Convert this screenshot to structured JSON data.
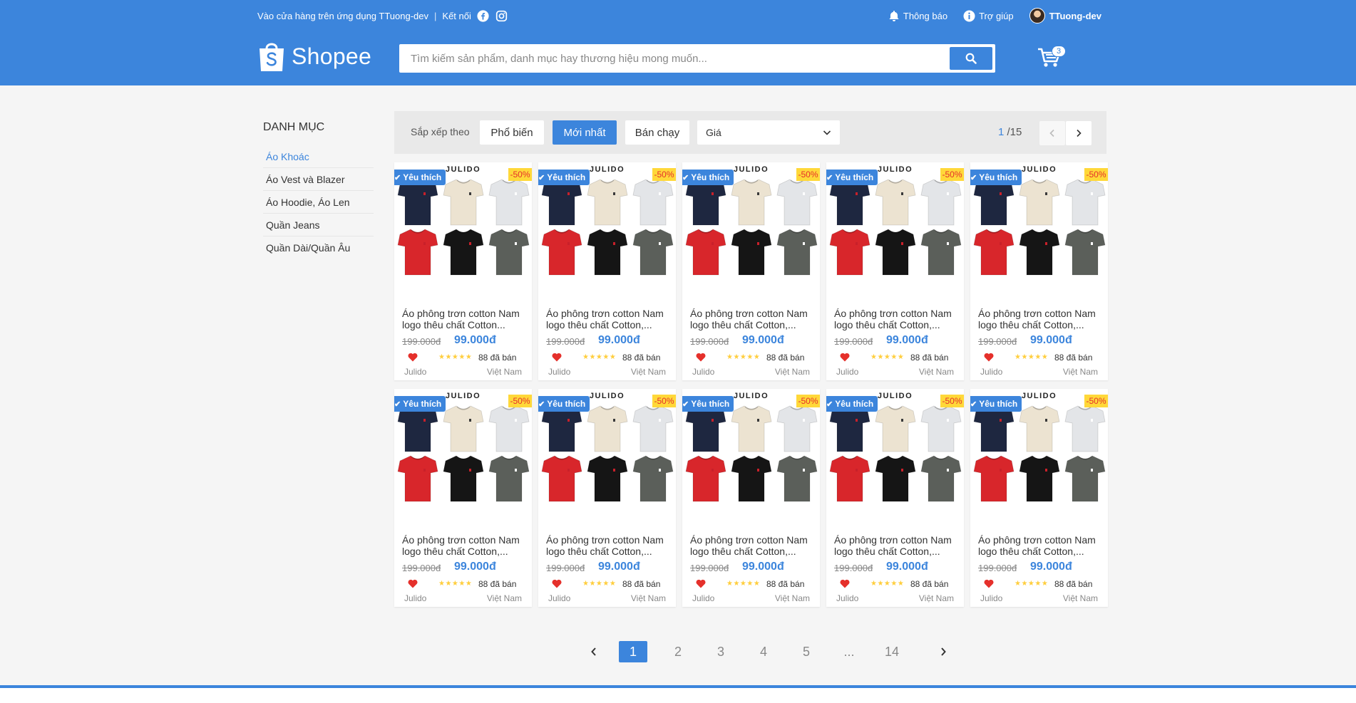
{
  "header": {
    "store_link": "Vào cửa hàng trên ứng dụng TTuong-dev",
    "connect_label": "Kết nối",
    "notification_label": "Thông báo",
    "help_label": "Trợ giúp",
    "username": "TTuong-dev",
    "logo_text": "Shopee",
    "search_placeholder": "Tìm kiếm sản phẩm, danh mục hay thương hiệu mong muốn...",
    "cart_count": "3",
    "brand_color": "#3c85dc"
  },
  "sidebar": {
    "title": "DANH MỤC",
    "items": [
      {
        "label": "Áo Khoác",
        "active": true
      },
      {
        "label": "Áo Vest và Blazer",
        "active": false
      },
      {
        "label": "Áo Hoodie, Áo Len",
        "active": false
      },
      {
        "label": "Quần Jeans",
        "active": false
      },
      {
        "label": "Quần Dài/Quần Âu",
        "active": false
      }
    ]
  },
  "filter": {
    "sort_label": "Sắp xếp theo",
    "buttons": [
      {
        "label": "Phổ biến",
        "active": false
      },
      {
        "label": "Mới nhất",
        "active": true
      },
      {
        "label": "Bán chạy",
        "active": false
      }
    ],
    "price_select": "Giá",
    "current_page": "1",
    "total_pages": "/15"
  },
  "products": [
    {
      "name": "Áo phông trơn cotton Nam logo thêu chất Cotton...",
      "old_price": "199.000đ",
      "price": "99.000đ",
      "sold": "88 đã bán",
      "shop": "Julido",
      "origin": "Việt Nam",
      "badge": "Yêu thích",
      "discount": "-50%",
      "brand": "JULIDO",
      "rating": "★★★★★"
    },
    {
      "name": "Áo phông trơn cotton Nam logo thêu chất Cotton,...",
      "old_price": "199.000đ",
      "price": "99.000đ",
      "sold": "88 đã bán",
      "shop": "Julido",
      "origin": "Việt Nam",
      "badge": "Yêu thích",
      "discount": "-50%",
      "brand": "JULIDO",
      "rating": "★★★★★"
    },
    {
      "name": "Áo phông trơn cotton Nam logo thêu chất Cotton,...",
      "old_price": "199.000đ",
      "price": "99.000đ",
      "sold": "88 đã bán",
      "shop": "Julido",
      "origin": "Việt Nam",
      "badge": "Yêu thích",
      "discount": "-50%",
      "brand": "JULIDO",
      "rating": "★★★★★"
    },
    {
      "name": "Áo phông trơn cotton Nam logo thêu chất Cotton,...",
      "old_price": "199.000đ",
      "price": "99.000đ",
      "sold": "88 đã bán",
      "shop": "Julido",
      "origin": "Việt Nam",
      "badge": "Yêu thích",
      "discount": "-50%",
      "brand": "JULIDO",
      "rating": "★★★★★"
    },
    {
      "name": "Áo phông trơn cotton Nam logo thêu chất Cotton,...",
      "old_price": "199.000đ",
      "price": "99.000đ",
      "sold": "88 đã bán",
      "shop": "Julido",
      "origin": "Việt Nam",
      "badge": "Yêu thích",
      "discount": "-50%",
      "brand": "JULIDO",
      "rating": "★★★★★"
    },
    {
      "name": "Áo phông trơn cotton Nam logo thêu chất Cotton,...",
      "old_price": "199.000đ",
      "price": "99.000đ",
      "sold": "88 đã bán",
      "shop": "Julido",
      "origin": "Việt Nam",
      "badge": "Yêu thích",
      "discount": "-50%",
      "brand": "JULIDO",
      "rating": "★★★★★"
    },
    {
      "name": "Áo phông trơn cotton Nam logo thêu chất Cotton,...",
      "old_price": "199.000đ",
      "price": "99.000đ",
      "sold": "88 đã bán",
      "shop": "Julido",
      "origin": "Việt Nam",
      "badge": "Yêu thích",
      "discount": "-50%",
      "brand": "JULIDO",
      "rating": "★★★★★"
    },
    {
      "name": "Áo phông trơn cotton Nam logo thêu chất Cotton,...",
      "old_price": "199.000đ",
      "price": "99.000đ",
      "sold": "88 đã bán",
      "shop": "Julido",
      "origin": "Việt Nam",
      "badge": "Yêu thích",
      "discount": "-50%",
      "brand": "JULIDO",
      "rating": "★★★★★"
    },
    {
      "name": "Áo phông trơn cotton Nam logo thêu chất Cotton,...",
      "old_price": "199.000đ",
      "price": "99.000đ",
      "sold": "88 đã bán",
      "shop": "Julido",
      "origin": "Việt Nam",
      "badge": "Yêu thích",
      "discount": "-50%",
      "brand": "JULIDO",
      "rating": "★★★★★"
    },
    {
      "name": "Áo phông trơn cotton Nam logo thêu chất Cotton,...",
      "old_price": "199.000đ",
      "price": "99.000đ",
      "sold": "88 đã bán",
      "shop": "Julido",
      "origin": "Việt Nam",
      "badge": "Yêu thích",
      "discount": "-50%",
      "brand": "JULIDO",
      "rating": "★★★★★"
    }
  ],
  "shirt_colors": [
    "#1e2740",
    "#ece3d1",
    "#e3e5e8",
    "#d8262b",
    "#151515",
    "#5b5f5a"
  ],
  "pagination": {
    "prev": "‹",
    "pages": [
      "1",
      "2",
      "3",
      "4",
      "5",
      "...",
      "14"
    ],
    "active": "1",
    "next": "›"
  }
}
